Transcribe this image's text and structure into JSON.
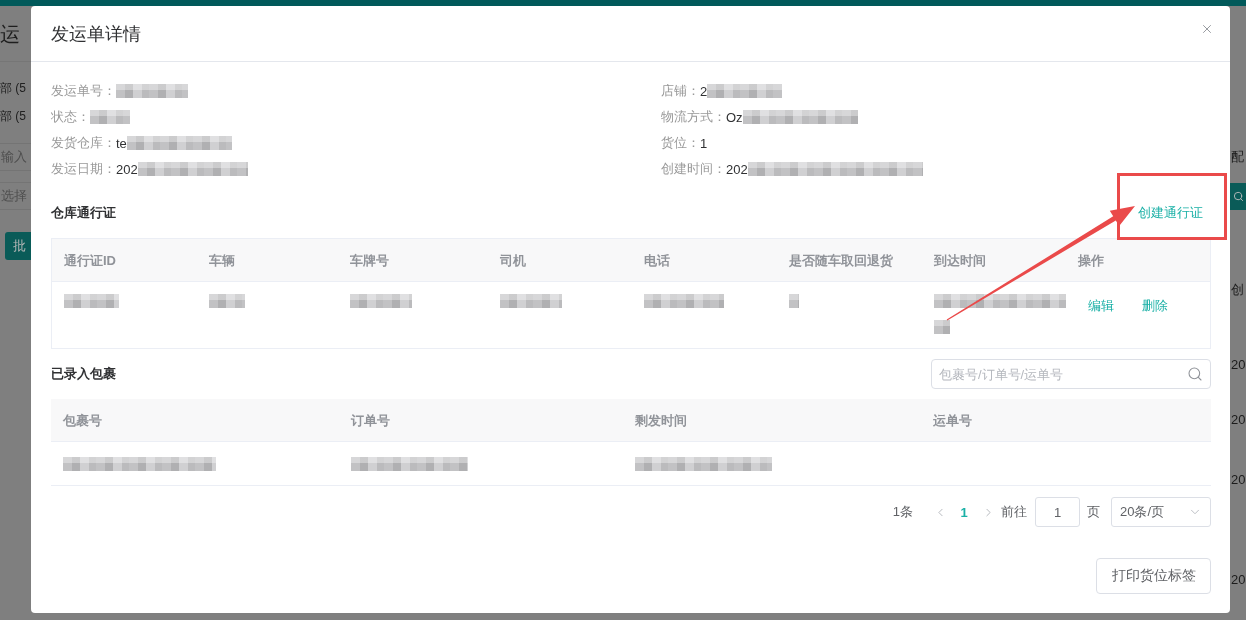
{
  "background_page": {
    "heading": "运",
    "filters": [
      "部 (5",
      "部 (5"
    ],
    "input_placeholder": "输入",
    "select_placeholder": "选择",
    "button": "批",
    "right_button_label": "配",
    "right_column_header": "创",
    "right_cells": [
      "20",
      "20",
      "20",
      "20"
    ]
  },
  "dialog": {
    "title": "发运单详情",
    "fields_left": [
      {
        "label": "发运单号：",
        "redacted": true
      },
      {
        "label": "状态：",
        "redacted": true
      },
      {
        "label": "发货仓库：",
        "value": "te",
        "redacted": true
      },
      {
        "label": "发运日期：",
        "value": "202",
        "redacted": true
      }
    ],
    "fields_right": [
      {
        "label": "店铺：",
        "value": "2",
        "redacted": true
      },
      {
        "label": "物流方式：",
        "value": "Oz",
        "redacted": true
      },
      {
        "label": "货位：",
        "value": "1",
        "redacted": false
      },
      {
        "label": "创建时间：",
        "value": "202",
        "redacted": true
      }
    ],
    "pass_section": {
      "title": "仓库通行证",
      "create_link": "创建通行证",
      "columns": [
        "通行证ID",
        "车辆",
        "车牌号",
        "司机",
        "电话",
        "是否随车取回退货",
        "到达时间",
        "操作"
      ],
      "rows": [
        {
          "cells": [
            {
              "redacted": true
            },
            {
              "redacted": true
            },
            {
              "redacted": true
            },
            {
              "redacted": true
            },
            {
              "redacted": true
            },
            {
              "redacted": true
            },
            {
              "redacted": true
            }
          ],
          "actions": [
            "编辑",
            "删除"
          ]
        }
      ]
    },
    "parcels_section": {
      "title": "已录入包裹",
      "search": {
        "placeholder": "包裹号/订单号/运单号"
      },
      "columns": [
        "包裹号",
        "订单号",
        "剩发时间",
        "运单号"
      ],
      "rows": [
        {
          "cells": [
            {
              "redacted": true
            },
            {
              "redacted": true
            },
            {
              "redacted": true
            },
            {
              "redacted": false
            }
          ]
        }
      ]
    },
    "pagination": {
      "total": "1条",
      "pages": [
        {
          "label": "1",
          "selected": true
        }
      ],
      "goto_label": "前往",
      "goto_value": "1",
      "page_unit": "页",
      "page_size": "20条/页"
    },
    "footer_button": "打印货位标签"
  }
}
